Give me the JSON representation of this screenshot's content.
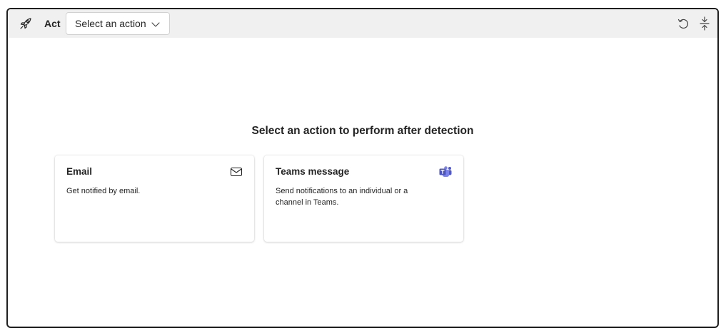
{
  "toolbar": {
    "act_label": "Act",
    "select": {
      "value": "Select an action"
    }
  },
  "main": {
    "heading": "Select an action to perform after detection",
    "cards": [
      {
        "title": "Email",
        "description": "Get notified by email.",
        "icon": "mail-icon"
      },
      {
        "title": "Teams message",
        "description": "Send notifications to an individual or a channel in Teams.",
        "icon": "teams-icon"
      }
    ]
  },
  "colors": {
    "toolbar_bg": "#f0f0f0",
    "teams_brand": "#5059c9"
  }
}
